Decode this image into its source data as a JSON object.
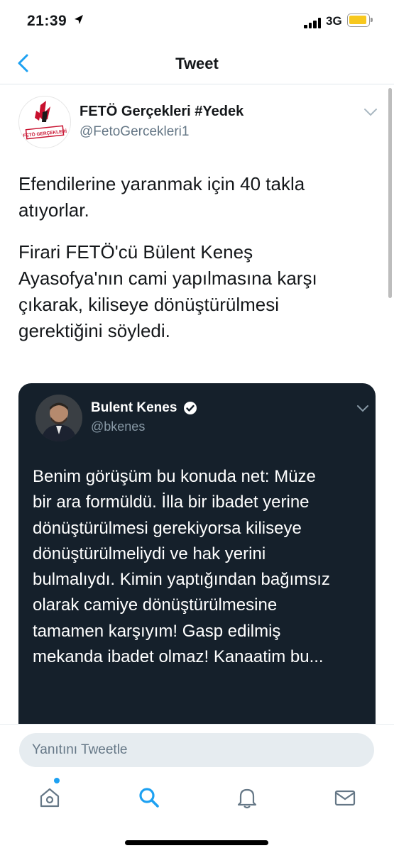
{
  "status_bar": {
    "time": "21:39",
    "network": "3G",
    "battery_level": 0.8
  },
  "nav": {
    "title": "Tweet"
  },
  "tweet": {
    "author_name": "FETÖ Gerçekleri #Yedek",
    "author_handle": "@FetoGercekleri1",
    "avatar_text": "FETÖ GERÇEKLERİ",
    "paragraphs": [
      "Efendilerine yaranmak için 40 takla\natıyorlar.",
      "Firari FETÖ'cü Bülent Keneş\nAyasofya'nın cami yapılmasına karşı\nçıkarak, kiliseye dönüştürülmesi\ngerektiğini söyledi."
    ]
  },
  "quoted_tweet": {
    "author_name": "Bulent Kenes",
    "author_handle": "@bkenes",
    "text": "Benim görüşüm bu konuda net: Müze\nbir ara formüldü. İlla bir ibadet yerine\ndönüştürülmesi gerekiyorsa kiliseye\ndönüştürülmeliydi ve hak yerini\nbulmalıydı. Kimin yaptığından bağımsız\nolarak camiye dönüştürülmesine\ntamamen karşıyım! Gasp edilmiş\nmekanda ibadet olmaz! Kanaatim bu..."
  },
  "reply": {
    "placeholder": "Yanıtını Tweetle"
  },
  "tabs": [
    "home-icon",
    "search-icon",
    "bell-icon",
    "mail-icon"
  ],
  "colors": {
    "accent": "#1da1f2",
    "quote_bg": "#15202b"
  }
}
